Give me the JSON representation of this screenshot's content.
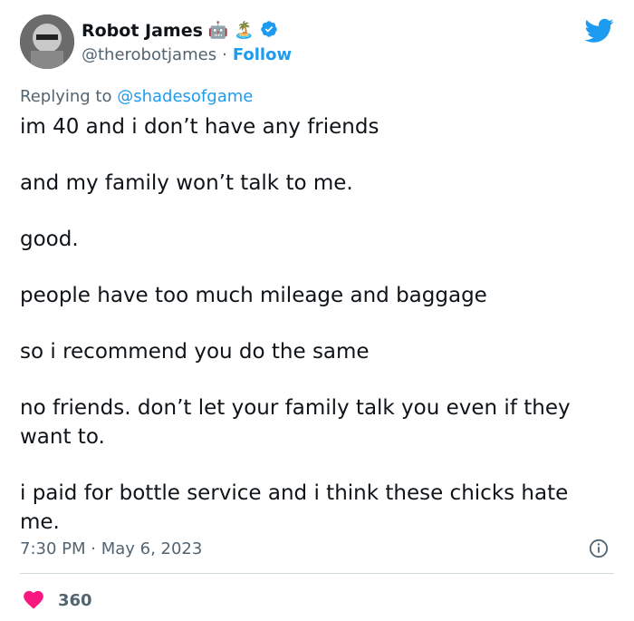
{
  "author": {
    "display_name": "Robot James",
    "emojis": [
      "🤖",
      "🏝️"
    ],
    "handle": "@therobotjames",
    "separator": "·",
    "follow_label": "Follow"
  },
  "reply": {
    "prefix": "Replying to",
    "mention": "@shadesofgame"
  },
  "tweet": {
    "paragraphs": [
      "im 40 and i don’t have any friends",
      "and my family won’t talk to me.",
      "good.",
      "people have too much mileage and baggage",
      "so i recommend you do the same",
      "no friends. don’t let your family talk you even if they want to.",
      "i paid for bottle service and i think these chicks hate me."
    ],
    "timestamp": "7:30 PM · May 6, 2023"
  },
  "engagement": {
    "likes": "360"
  },
  "colors": {
    "accent": "#1d9bf0",
    "like": "#f91880",
    "muted": "#536471"
  },
  "icons": [
    "twitter-bird-icon",
    "verified-badge-icon",
    "info-icon",
    "heart-icon"
  ]
}
